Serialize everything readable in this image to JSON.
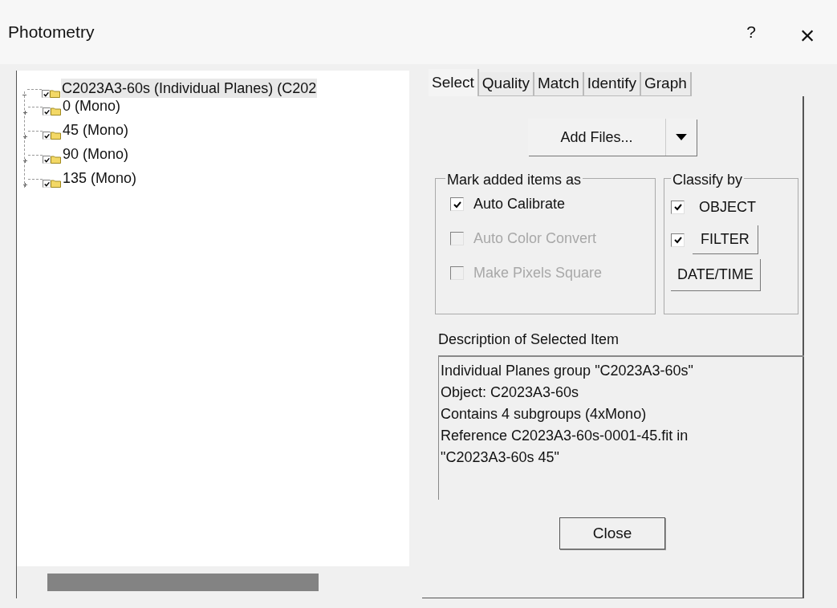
{
  "window": {
    "title": "Photometry",
    "help": "?",
    "close": "×"
  },
  "tree": {
    "items": [
      {
        "label": "C2023A3-60s (Individual Planes) (C202",
        "checked": true,
        "expanded": true,
        "selected": true,
        "children": [
          {
            "label": "0 (Mono)",
            "checked": true,
            "expanded": false,
            "selected": false
          },
          {
            "label": "45 (Mono)",
            "checked": true,
            "expanded": false,
            "selected": false
          },
          {
            "label": "90 (Mono)",
            "checked": true,
            "expanded": false,
            "selected": false
          },
          {
            "label": "135 (Mono)",
            "checked": true,
            "expanded": false,
            "selected": false
          }
        ]
      }
    ]
  },
  "tabs": [
    {
      "label": "Select",
      "selected": true
    },
    {
      "label": "Quality",
      "selected": false
    },
    {
      "label": "Match",
      "selected": false
    },
    {
      "label": "Identify",
      "selected": false
    },
    {
      "label": "Graph",
      "selected": false
    }
  ],
  "add_files": {
    "label": "Add Files..."
  },
  "mark_group": {
    "title": "Mark added items as",
    "options": [
      {
        "label": "Auto Calibrate",
        "checked": true,
        "disabled": false
      },
      {
        "label": "Auto Color Convert",
        "checked": false,
        "disabled": true
      },
      {
        "label": "Make Pixels Square",
        "checked": false,
        "disabled": true
      }
    ]
  },
  "classify_group": {
    "title": "Classify by",
    "options": [
      {
        "kind": "checkbox",
        "label": "OBJECT",
        "checked": true
      },
      {
        "kind": "checkbox-button",
        "label": "FILTER",
        "checked": true
      },
      {
        "kind": "button",
        "label": "DATE/TIME"
      }
    ]
  },
  "description": {
    "title": "Description of Selected Item",
    "lines": [
      "Individual Planes group \"C2023A3-60s\"",
      "Object: C2023A3-60s",
      "Contains 4 subgroups (4xMono)",
      "Reference C2023A3-60s-0001-45.fit in",
      "\"C2023A3-60s 45\""
    ]
  },
  "buttons": {
    "close": "Close"
  }
}
